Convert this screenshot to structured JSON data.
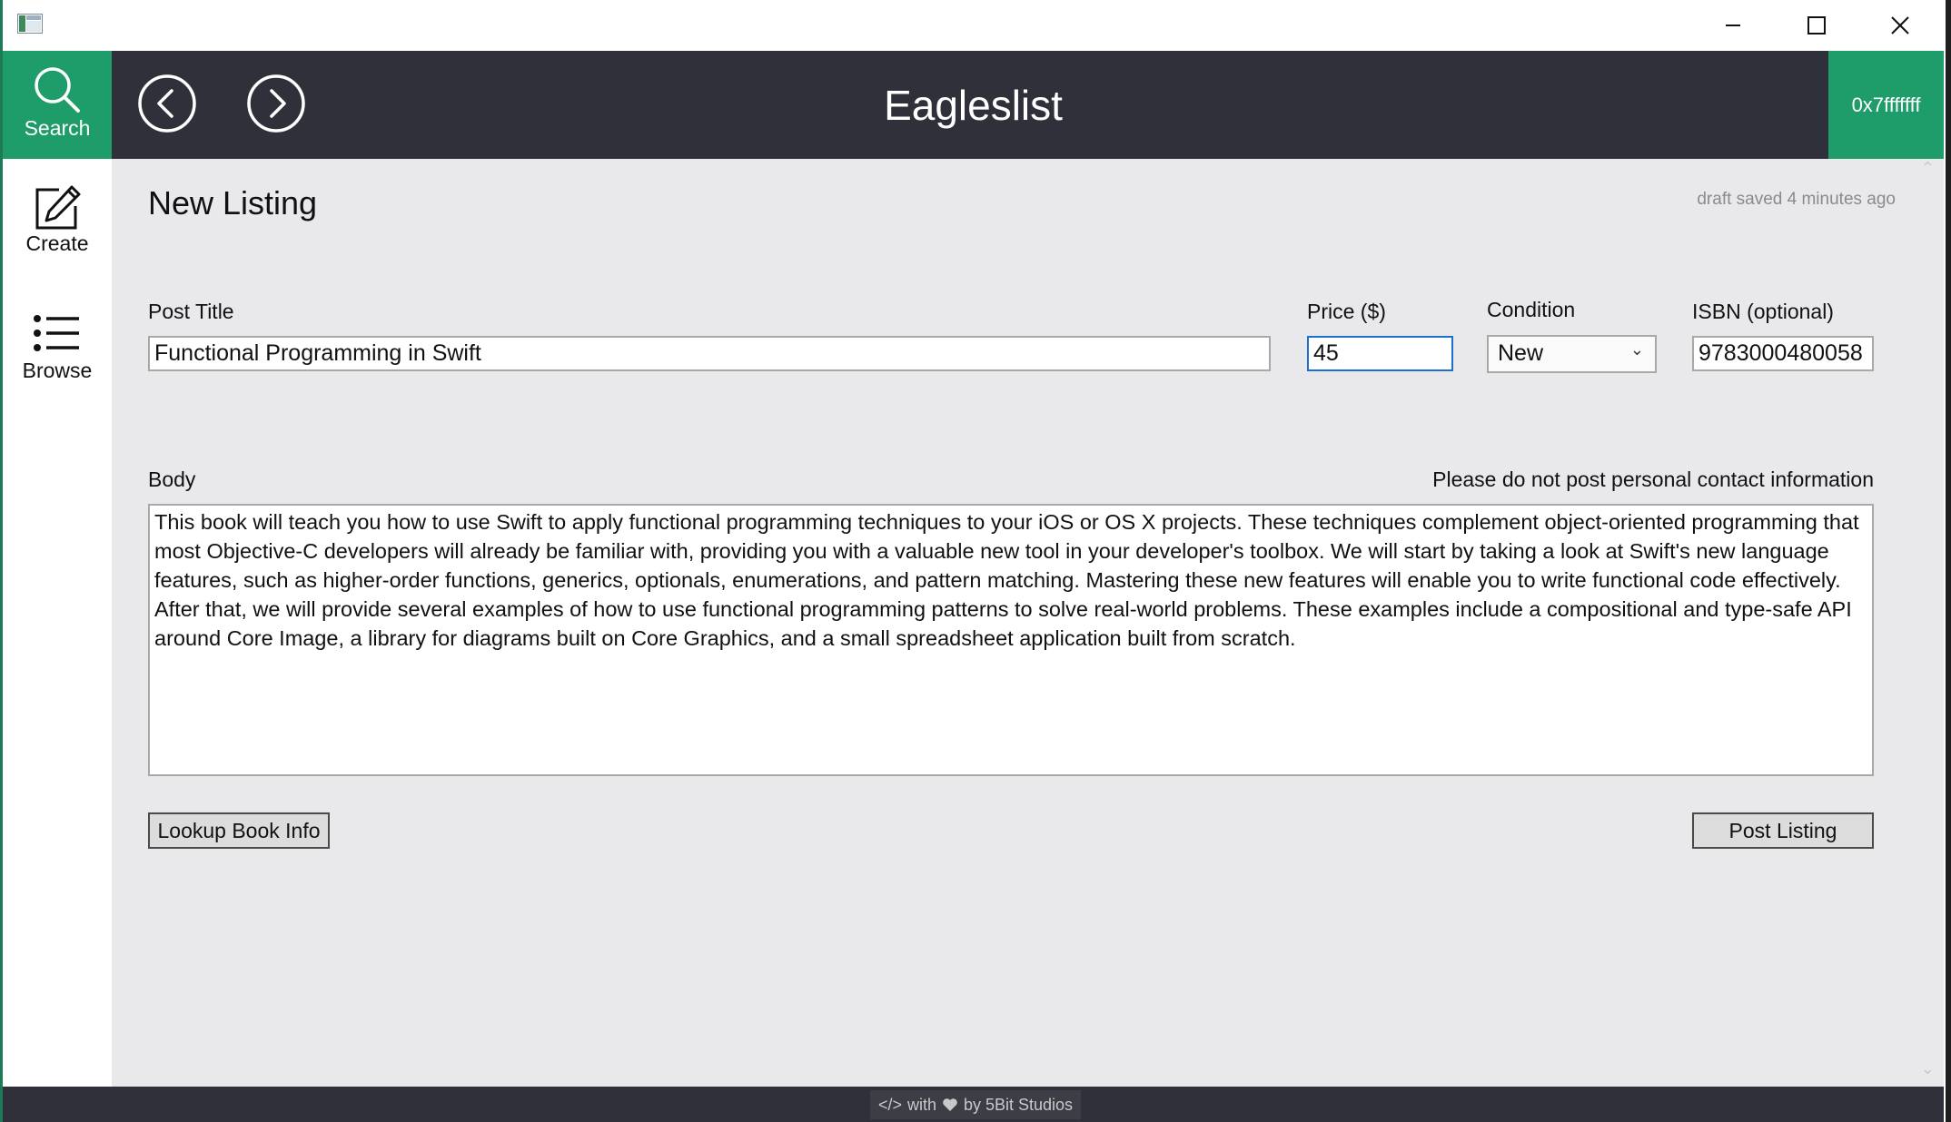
{
  "window": {
    "minimize_icon": "minimize-icon",
    "maximize_icon": "maximize-icon",
    "close_icon": "close-icon"
  },
  "header": {
    "search_label": "Search",
    "title": "Eagleslist",
    "user_label": "0x7fffffff",
    "accent_color": "#1e9c6a",
    "bar_color": "#2f3039"
  },
  "sidebar": {
    "items": [
      {
        "label": "Create",
        "icon": "pencil-edit-icon"
      },
      {
        "label": "Browse",
        "icon": "list-icon"
      }
    ]
  },
  "main": {
    "page_title": "New Listing",
    "draft_status": "draft saved 4 minutes ago",
    "post_title_label": "Post Title",
    "post_title_value": "Functional Programming in Swift",
    "price_label": "Price ($)",
    "price_value": "45",
    "condition_label": "Condition",
    "condition_value": "New",
    "isbn_label": "ISBN (optional)",
    "isbn_value": "9783000480058",
    "body_label": "Body",
    "body_hint": "Please do not post personal contact information",
    "body_value": "This book will teach you how to use Swift to apply functional programming techniques to your iOS or OS X projects. These techniques complement object-oriented programming that most Objective-C developers will already be familiar with, providing you with a valuable new tool in your developer's toolbox. We will start by taking a look at Swift's new language features, such as higher-order functions, generics, optionals, enumerations, and pattern matching. Mastering these new features will enable you to write functional code effectively. After that, we will provide several examples of how to use functional programming patterns to solve real-world problems. These examples include a compositional and type-safe API around Core Image, a library for diagrams built on Core Graphics, and a small spreadsheet application built from scratch.",
    "lookup_button": "Lookup Book Info",
    "post_button": "Post Listing"
  },
  "footer": {
    "code_glyph": "</>",
    "with_text": "with",
    "by_text": "by 5Bit Studios"
  }
}
